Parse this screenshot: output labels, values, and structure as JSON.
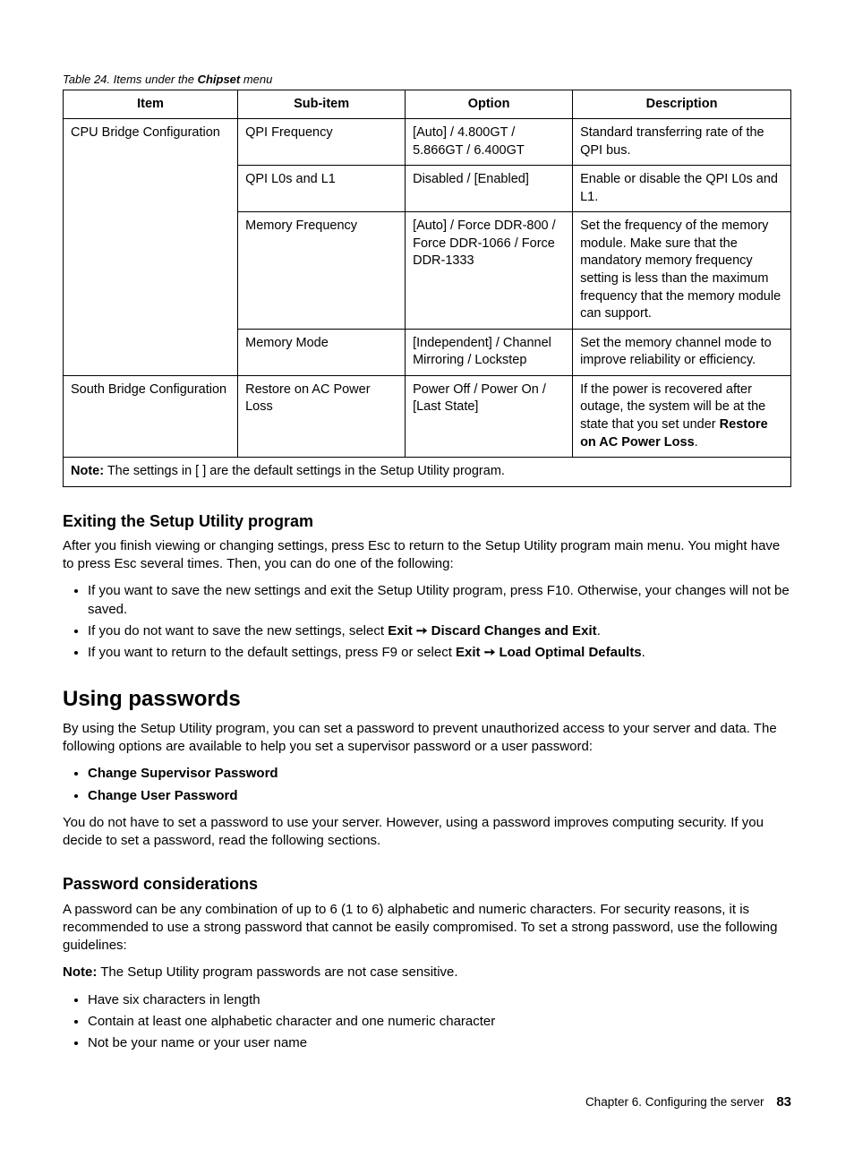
{
  "caption": {
    "prefix": "Table 24.  Items under the ",
    "bold": "Chipset",
    "suffix": " menu"
  },
  "headers": [
    "Item",
    "Sub-item",
    "Option",
    "Description"
  ],
  "rows": [
    {
      "item": "CPU Bridge Configuration",
      "sub": "QPI Frequency",
      "opt": "[Auto] / 4.800GT / 5.866GT / 6.400GT",
      "desc": "Standard transferring rate of the QPI bus."
    },
    {
      "item": "",
      "sub": "QPI L0s and L1",
      "opt": "Disabled / [Enabled]",
      "desc": "Enable or disable the QPI L0s and L1."
    },
    {
      "item": "",
      "sub": "Memory Frequency",
      "opt": "[Auto] / Force DDR-800 / Force DDR-1066 / Force DDR-1333",
      "desc": "Set the frequency of the memory module.  Make sure that the mandatory memory frequency setting is less than the maximum frequency that the memory module can support."
    },
    {
      "item": "",
      "sub": "Memory Mode",
      "opt": "[Independent] / Channel Mirroring / Lockstep",
      "desc": "Set the memory channel mode to improve reliability or efficiency."
    },
    {
      "item": "South Bridge Configuration",
      "sub": "Restore on AC Power Loss",
      "opt": "Power Off / Power On / [Last State]",
      "desc_pre": "If the power is recovered after outage, the system will be at the state that you set under ",
      "desc_bold": "Restore on AC Power Loss",
      "desc_post": "."
    }
  ],
  "note": {
    "label": "Note:",
    "text": " The settings in [ ] are the default settings in the Setup Utility program."
  },
  "exiting": {
    "heading": "Exiting the Setup Utility program",
    "p1": "After you finish viewing or changing settings, press Esc to return to the Setup Utility program main menu. You might have to press Esc several times.  Then, you can do one of the following:",
    "li1": "If you want to save the new settings and exit the Setup Utility program, press F10.  Otherwise, your changes will not be saved.",
    "li2_pre": "If you do not want to save the new settings, select ",
    "li2_b1": "Exit",
    "li2_arrow": " ➙ ",
    "li2_b2": "Discard Changes and Exit",
    "li2_post": ".",
    "li3_pre": "If you want to return to the default settings, press F9 or select ",
    "li3_b1": "Exit",
    "li3_arrow": " ➙ ",
    "li3_b2": "Load Optimal Defaults",
    "li3_post": "."
  },
  "passwords": {
    "heading": "Using passwords",
    "p1": "By using the Setup Utility program, you can set a password to prevent unauthorized access to your server and data. The following options are available to help you set a supervisor password or a user password:",
    "li1": "Change Supervisor Password",
    "li2": "Change User Password",
    "p2": "You do not have to set a password to use your server.  However, using a password improves computing security.  If you decide to set a password, read the following sections."
  },
  "considerations": {
    "heading": "Password considerations",
    "p1": "A password can be any combination of up to 6 (1 to 6) alphabetic and numeric characters.  For security reasons, it is recommended to use a strong password that cannot be easily compromised.  To set a strong password, use the following guidelines:",
    "note_label": "Note:",
    "note_text": " The Setup Utility program passwords are not case sensitive.",
    "li1": "Have six characters in length",
    "li2": "Contain at least one alphabetic character and one numeric character",
    "li3": "Not be your name or your user name"
  },
  "footer": {
    "chapter": "Chapter 6.  Configuring the server",
    "page": "83"
  }
}
